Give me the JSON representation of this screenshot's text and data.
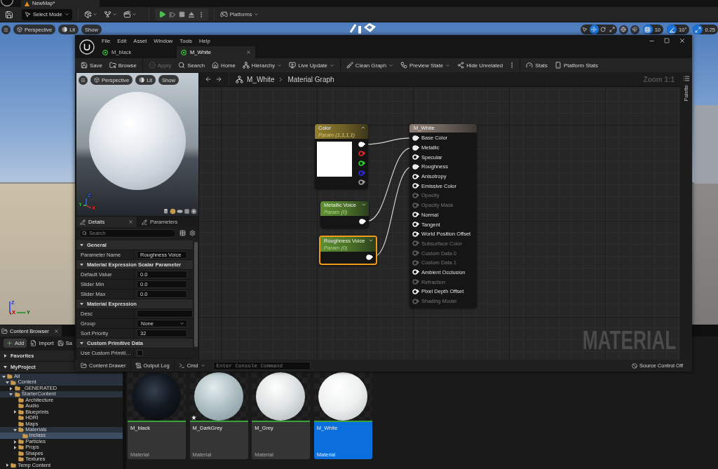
{
  "editor": {
    "map_tab": "NewMap*",
    "toolbar": {
      "mode": "Select Mode",
      "platforms": "Platforms"
    },
    "viewport": {
      "menu": [
        "Perspective",
        "Lit",
        "Show"
      ],
      "transform_tools": [
        {
          "selected": false
        },
        {
          "selected": true
        },
        {
          "selected": false
        },
        {
          "selected": false
        }
      ],
      "snaps": [
        {
          "value": "10",
          "on": true
        },
        {
          "value": "10°",
          "on": true
        },
        {
          "value": "0.25",
          "on": true
        }
      ],
      "axis_labels": [
        "Z",
        "Y",
        "X"
      ]
    }
  },
  "material_editor": {
    "menu": [
      "File",
      "Edit",
      "Asset",
      "Window",
      "Tools",
      "Help"
    ],
    "tabs": [
      {
        "label": "M_black",
        "selected": false
      },
      {
        "label": "M_White",
        "selected": true
      }
    ],
    "toolbar": [
      [
        {
          "kind": "button",
          "label": "Save",
          "dropdown": false,
          "disabled": false
        },
        {
          "kind": "button",
          "label": "Browse",
          "dropdown": false,
          "disabled": false
        }
      ],
      [
        {
          "kind": "button",
          "label": "Apply",
          "dropdown": false,
          "disabled": true
        },
        {
          "kind": "button",
          "label": "Search",
          "dropdown": false,
          "disabled": false
        },
        {
          "kind": "button",
          "label": "Home",
          "dropdown": false,
          "disabled": false
        },
        {
          "kind": "button",
          "label": "Hierarchy",
          "dropdown": true,
          "disabled": false
        },
        {
          "kind": "button",
          "label": "Live Update",
          "dropdown": true,
          "disabled": false
        }
      ],
      [
        {
          "kind": "button",
          "label": "Clean Graph",
          "dropdown": true,
          "disabled": false
        },
        {
          "kind": "button",
          "label": "Preview State",
          "dropdown": true,
          "disabled": false
        },
        {
          "kind": "button",
          "label": "Hide Unrelated",
          "dropdown": false,
          "disabled": false
        },
        {
          "kind": "more"
        }
      ],
      [
        {
          "kind": "button",
          "label": "Stats",
          "dropdown": false,
          "disabled": false
        },
        {
          "kind": "button",
          "label": "Platform Stats",
          "dropdown": false,
          "disabled": false
        }
      ]
    ],
    "preview": {
      "menu": [
        "Perspective",
        "Lit",
        "Show"
      ],
      "axis_labels": [
        "Z",
        "Y",
        "X"
      ]
    },
    "details": {
      "tabs": [
        {
          "label": "Details",
          "selected": true
        },
        {
          "label": "Parameters",
          "selected": false
        }
      ],
      "search": {
        "placeholder": "Search"
      },
      "sections": [
        {
          "title": "General",
          "expanded": true,
          "rows": [
            {
              "label": "Parameter Name",
              "kind": "text",
              "value": "Roughness Voice"
            }
          ]
        },
        {
          "title": "Material Expression Scalar Parameter",
          "expanded": true,
          "rows": [
            {
              "label": "Default Value",
              "kind": "text",
              "value": "0.0"
            },
            {
              "label": "Slider Min",
              "kind": "text",
              "value": "0.0"
            },
            {
              "label": "Slider Max",
              "kind": "text",
              "value": "0.0"
            }
          ]
        },
        {
          "title": "Material Expression",
          "expanded": true,
          "rows": [
            {
              "label": "Desc",
              "kind": "text"
            },
            {
              "label": "Group",
              "kind": "dropdown",
              "value": "None"
            },
            {
              "label": "Sort Priority",
              "kind": "text",
              "value": "32"
            }
          ]
        },
        {
          "title": "Custom Primitive Data",
          "expanded": true,
          "rows": [
            {
              "label": "Use Custom Primiti…",
              "kind": "checkbox",
              "checked": false
            }
          ]
        }
      ]
    },
    "graph": {
      "breadcrumb": [
        "M_White",
        "Material Graph"
      ],
      "zoom": "Zoom 1:1",
      "type_label": "MATERIAL",
      "nodes": [
        {
          "kind": "vector",
          "title": "Color",
          "subtitle": "Param (1,1,1,1)",
          "selected": false,
          "expanded": true,
          "outputs": [
            {
              "color": "#ffffff",
              "connected": true
            },
            {
              "color": "#e02424",
              "connected": false
            },
            {
              "color": "#22d022",
              "connected": false
            },
            {
              "color": "#2a2ae6",
              "connected": false
            },
            {
              "color": "#9a9a9a",
              "connected": false
            }
          ]
        },
        {
          "kind": "scalar",
          "title": "Metallic Voice",
          "subtitle": "Param (0)",
          "selected": false,
          "expanded": false,
          "outputs": [
            {
              "color": "#ffffff",
              "connected": true
            }
          ]
        },
        {
          "kind": "scalar",
          "title": "Roughness Voice",
          "subtitle": "Param (0)",
          "selected": true,
          "expanded": false,
          "outputs": [
            {
              "color": "#ffffff",
              "connected": true
            }
          ]
        }
      ],
      "result": {
        "title": "M_White",
        "inputs": [
          {
            "label": "Base Color",
            "connected": true,
            "disabled": false
          },
          {
            "label": "Metallic",
            "connected": true,
            "disabled": false
          },
          {
            "label": "Specular",
            "connected": false,
            "disabled": false
          },
          {
            "label": "Roughness",
            "connected": true,
            "disabled": false
          },
          {
            "label": "Anisotropy",
            "connected": false,
            "disabled": false
          },
          {
            "label": "Emissive Color",
            "connected": false,
            "disabled": false
          },
          {
            "label": "Opacity",
            "connected": false,
            "disabled": true
          },
          {
            "label": "Opacity Mask",
            "connected": false,
            "disabled": true
          },
          {
            "label": "Normal",
            "connected": false,
            "disabled": false
          },
          {
            "label": "Tangent",
            "connected": false,
            "disabled": false
          },
          {
            "label": "World Position Offset",
            "connected": false,
            "disabled": false
          },
          {
            "label": "Subsurface Color",
            "connected": false,
            "disabled": true
          },
          {
            "label": "Custom Data 0",
            "connected": false,
            "disabled": true
          },
          {
            "label": "Custom Data 1",
            "connected": false,
            "disabled": true
          },
          {
            "label": "Ambient Occlusion",
            "connected": false,
            "disabled": false
          },
          {
            "label": "Refraction",
            "connected": false,
            "disabled": true
          },
          {
            "label": "Pixel Depth Offset",
            "connected": false,
            "disabled": false
          },
          {
            "label": "Shading Model",
            "connected": false,
            "disabled": true
          }
        ]
      }
    },
    "palette": "Palette",
    "status_bar": {
      "content_drawer": "Content Drawer",
      "output_log": "Output Log",
      "cmd": "Cmd",
      "console": {
        "placeholder": "Enter Console Command"
      },
      "source_control": "Source Control Off"
    }
  },
  "content_browser": {
    "tab": "Content Browser",
    "toolbar": [
      {
        "label": "Add",
        "kind": "primary"
      },
      {
        "label": "Import",
        "kind": "plain"
      },
      {
        "label": "Sa",
        "kind": "plain"
      }
    ],
    "sections": [
      {
        "title": "Favorites",
        "expanded": false
      },
      {
        "title": "MyProject",
        "expanded": true,
        "tree": [
          {
            "label": "All",
            "expanded": true,
            "selected": false,
            "highlighted": true,
            "children": [
              {
                "label": "Content",
                "expanded": true,
                "selected": false,
                "highlighted": true,
                "children": [
                  {
                    "label": "_GENERATED",
                    "expanded": false,
                    "selected": false,
                    "highlighted": false
                  },
                  {
                    "label": "StarterContent",
                    "expanded": true,
                    "selected": false,
                    "highlighted": true,
                    "children": [
                      {
                        "label": "Architecture",
                        "selected": false,
                        "highlighted": false
                      },
                      {
                        "label": "Audio",
                        "selected": false,
                        "highlighted": false
                      },
                      {
                        "label": "Blueprints",
                        "expanded": false,
                        "selected": false,
                        "highlighted": false
                      },
                      {
                        "label": "HDRI",
                        "selected": false,
                        "highlighted": false
                      },
                      {
                        "label": "Maps",
                        "selected": false,
                        "highlighted": false
                      },
                      {
                        "label": "Materials",
                        "expanded": true,
                        "selected": false,
                        "highlighted": true,
                        "children": [
                          {
                            "label": "Inclass",
                            "selected": true,
                            "highlighted": false
                          }
                        ]
                      },
                      {
                        "label": "Particles",
                        "expanded": false,
                        "selected": false,
                        "highlighted": false
                      },
                      {
                        "label": "Props",
                        "expanded": false,
                        "selected": false,
                        "highlighted": false
                      },
                      {
                        "label": "Shapes",
                        "selected": false,
                        "highlighted": false
                      },
                      {
                        "label": "Textures",
                        "selected": false,
                        "highlighted": false
                      }
                    ]
                  }
                ]
              },
              {
                "label": "Temp Content",
                "expanded": false,
                "selected": false,
                "highlighted": false
              }
            ]
          }
        ]
      }
    ],
    "tiles": [
      {
        "name": "M_black",
        "type": "Material",
        "selected": false,
        "modified": false
      },
      {
        "name": "M_DarkGrey",
        "type": "Material",
        "selected": false,
        "modified": true
      },
      {
        "name": "M_Grey",
        "type": "Material",
        "selected": false,
        "modified": false
      },
      {
        "name": "M_White",
        "type": "Material",
        "selected": true,
        "modified": false
      }
    ]
  }
}
